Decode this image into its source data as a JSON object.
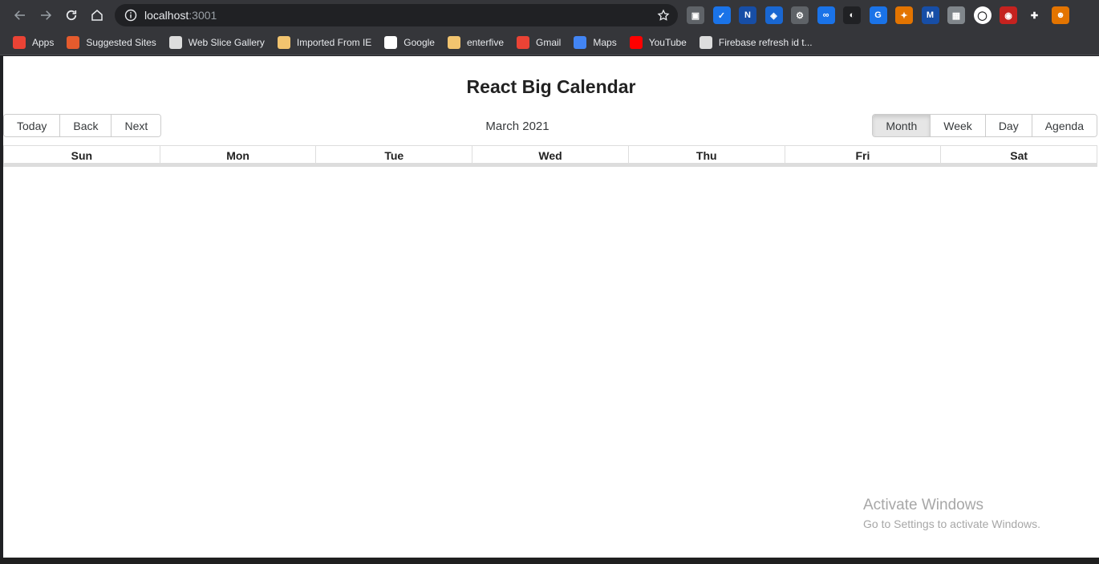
{
  "browser": {
    "url_host": "localhost",
    "url_port": ":3001",
    "bookmarks": [
      {
        "label": "Apps",
        "color": "#ea4335"
      },
      {
        "label": "Suggested Sites",
        "color": "#e55b2d"
      },
      {
        "label": "Web Slice Gallery",
        "color": "#dddddd"
      },
      {
        "label": "Imported From IE",
        "color": "#f2c46f"
      },
      {
        "label": "Google",
        "color": "#ffffff"
      },
      {
        "label": "enterfive",
        "color": "#f2c46f"
      },
      {
        "label": "Gmail",
        "color": "#ea4335"
      },
      {
        "label": "Maps",
        "color": "#4285f4"
      },
      {
        "label": "YouTube",
        "color": "#ff0000"
      },
      {
        "label": "Firebase refresh id t...",
        "color": "#dddddd"
      }
    ],
    "extensions": [
      {
        "name": "camera-extension-icon",
        "color": "#5f6368",
        "glyph": "▣"
      },
      {
        "name": "check-extension-icon",
        "color": "#1a73e8",
        "glyph": "✓"
      },
      {
        "name": "n-extension-icon",
        "color": "#174ea6",
        "glyph": "N"
      },
      {
        "name": "shield-extension-icon",
        "color": "#1967d2",
        "glyph": "◈"
      },
      {
        "name": "gear-extension-icon",
        "color": "#5f6368",
        "glyph": "⚙"
      },
      {
        "name": "link-extension-icon",
        "color": "#1a73e8",
        "glyph": "∞"
      },
      {
        "name": "dark-extension-icon",
        "color": "#202124",
        "glyph": "◐"
      },
      {
        "name": "grammarly-extension-icon",
        "color": "#1a73e8",
        "glyph": "G"
      },
      {
        "name": "swirl-extension-icon",
        "color": "#e37400",
        "glyph": "✦"
      },
      {
        "name": "m-extension-icon",
        "color": "#174ea6",
        "glyph": "M"
      },
      {
        "name": "box-extension-icon",
        "color": "#80868b",
        "glyph": "▦"
      },
      {
        "name": "circle-extension-icon",
        "color": "#ffffff",
        "glyph": "◯"
      },
      {
        "name": "owl-extension-icon",
        "color": "#c5221f",
        "glyph": "◉"
      },
      {
        "name": "puzzle-extension-icon",
        "color": "#35363a",
        "glyph": "✚"
      },
      {
        "name": "profile-avatar-icon",
        "color": "#e37400",
        "glyph": "☻"
      }
    ]
  },
  "page": {
    "title": "React Big Calendar",
    "nav_buttons": [
      "Today",
      "Back",
      "Next"
    ],
    "toolbar_label": "March 2021",
    "view_buttons": [
      "Month",
      "Week",
      "Day",
      "Agenda"
    ],
    "active_view": "Month",
    "weekdays": [
      "Sun",
      "Mon",
      "Tue",
      "Wed",
      "Thu",
      "Fri",
      "Sat"
    ]
  },
  "watermark": {
    "line1": "Activate Windows",
    "line2": "Go to Settings to activate Windows."
  },
  "colors": {
    "active_view_bg": "#e6e6e6",
    "border": "#dddddd"
  }
}
